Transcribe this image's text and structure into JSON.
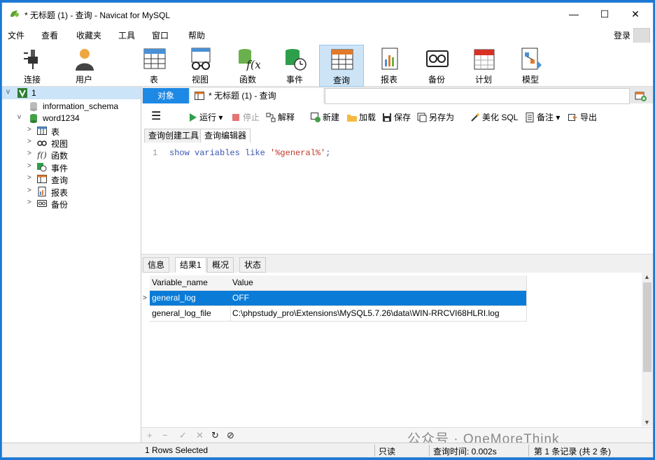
{
  "window": {
    "title": "* 无标题 (1) - 查询 - Navicat for MySQL",
    "minimize": "—",
    "maximize": "☐",
    "close": "✕"
  },
  "menu": [
    "文件",
    "查看",
    "收藏夹",
    "工具",
    "窗口",
    "帮助"
  ],
  "login": "登录",
  "toolbar": [
    "连接",
    "用户",
    "表",
    "视图",
    "函数",
    "事件",
    "查询",
    "报表",
    "备份",
    "计划",
    "模型"
  ],
  "tree": {
    "connection": "1",
    "db1": "information_schema",
    "db2": "word1234",
    "children": [
      "表",
      "视图",
      "函数",
      "事件",
      "查询",
      "报表",
      "备份"
    ]
  },
  "tabs": {
    "objects": "对象",
    "query": "* 无标题 (1) - 查询"
  },
  "query_toolbar": {
    "run": "运行",
    "stop": "停止",
    "explain": "解释",
    "new": "新建",
    "load": "加载",
    "save": "保存",
    "save_as": "另存为",
    "beautify": "美化 SQL",
    "comment": "备注",
    "export": "导出"
  },
  "subtabs": [
    "查询创建工具",
    "查询编辑器"
  ],
  "editor": {
    "line_no": "1",
    "code_kw": "show variables like ",
    "code_str": "'%general%'",
    "code_end": ";"
  },
  "result_tabs": [
    "信息",
    "结果1",
    "概况",
    "状态"
  ],
  "grid": {
    "columns": [
      "Variable_name",
      "Value"
    ],
    "rows": [
      [
        "general_log",
        "OFF"
      ],
      [
        "general_log_file",
        "C:\\phpstudy_pro\\Extensions\\MySQL5.7.26\\data\\WIN-RRCVI68HLRI.log"
      ]
    ]
  },
  "watermark": "公众号 · OneMoreThink",
  "status": {
    "selected": "1 Rows Selected",
    "readonly": "只读",
    "time": "查询时间: 0.002s",
    "records": "第 1 条记录 (共 2 条)"
  },
  "colors": {
    "accent": "#1e88e5",
    "selection": "#0a7bd7",
    "keyword": "#3a55b4",
    "string": "#c0392b"
  }
}
